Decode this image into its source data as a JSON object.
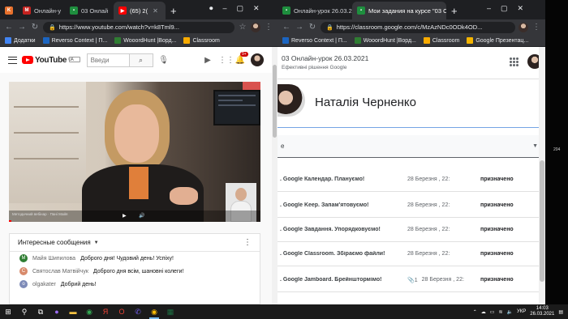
{
  "left_browser": {
    "tabs": [
      {
        "icon_label": "K",
        "icon_color": "#e8712c",
        "label": ""
      },
      {
        "icon_label": "M",
        "icon_color": "#c5221f",
        "label": "Онлайн-у"
      },
      {
        "icon_label": "▪",
        "icon_color": "#1e8e3e",
        "label": "03 Онлай"
      },
      {
        "icon_label": "▶",
        "icon_color": "#ff0000",
        "label": "(65) 2("
      }
    ],
    "url": "https://www.youtube.com/watch?v=k8Tml9...",
    "bookmarks": [
      {
        "label": "Додатки",
        "color": "#4285f4"
      },
      {
        "label": "Reverso Context | П...",
        "color": "#1b65c1"
      },
      {
        "label": "WooordHunt |Ворд...",
        "color": "#2f7d32"
      },
      {
        "label": "Classroom",
        "color": "#f9ab00"
      }
    ]
  },
  "youtube": {
    "logo_text": "YouTube",
    "region": "UA",
    "search_placeholder": "Введи",
    "notification_count": "9+",
    "video": {
      "caption": "Методичний вебінар · Пані Майя"
    },
    "chat": {
      "title": "Интересные сообщения",
      "messages": [
        {
          "initial": "M",
          "color": "#2e7d32",
          "author": "Майя Шипилова",
          "text": "Доброго дня! Чудовий день! Успіху!"
        },
        {
          "initial": "С",
          "color": "#d88a6b",
          "author": "Святослав Матвійчук",
          "text": "Доброго дня всім, шановні колеги!"
        },
        {
          "initial": "o",
          "color": "#7e8bb8",
          "author": "olgakater",
          "text": "Добрий день!"
        }
      ]
    }
  },
  "right_browser": {
    "tabs": [
      {
        "icon_label": "▪",
        "icon_color": "#1e8e3e",
        "label": "Онлайн-урок 26.03.2021 ( ×"
      },
      {
        "icon_label": "▪",
        "icon_color": "#1e8e3e",
        "label": "Мои задания на курсе \"03 О"
      }
    ],
    "url": "https://classroom.google.com/c/MzAzNDc0ODk4OD...",
    "bookmarks": [
      {
        "label": "Reverso Context | П...",
        "color": "#1b65c1"
      },
      {
        "label": "WooordHunt |Ворд...",
        "color": "#2f7d32"
      },
      {
        "label": "Classroom",
        "color": "#f9ab00"
      },
      {
        "label": "Google Презентац...",
        "color": "#f4b400"
      }
    ]
  },
  "classroom": {
    "class_title": "03 Онлайн-урок 26.03.2021",
    "class_subtitle": "Ефективні рішення Google",
    "student_name": "Наталія Черненко",
    "filter_label": "е",
    "tasks": [
      {
        "title": ". Google Календар. Плануємо!",
        "date": "28 Березня , 22:",
        "status": "призначено",
        "attachment": ""
      },
      {
        "title": ". Google Keep. Запам'ятовуємо!",
        "date": "28 Березня , 22:",
        "status": "призначено",
        "attachment": ""
      },
      {
        "title": ". Google Завдання. Упорядковуємо!",
        "date": "28 Березня , 22:",
        "status": "призначено",
        "attachment": ""
      },
      {
        "title": ". Google Classroom. Збіраємо файли!",
        "date": "28 Березня , 22:",
        "status": "призначено",
        "attachment": ""
      },
      {
        "title": ". Google Jamboard. Брейнштормімо!",
        "date": "28 Березня , 22:",
        "status": "призначено",
        "attachment": "1"
      }
    ]
  },
  "desktop_edge": {
    "num": "204"
  },
  "taskbar": {
    "language": "УКР",
    "time": "14:03",
    "date": "26.03.2021"
  }
}
